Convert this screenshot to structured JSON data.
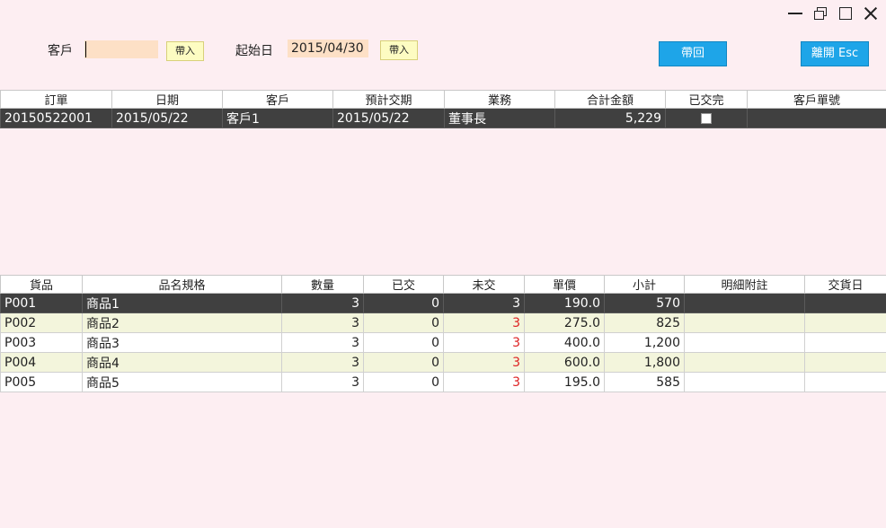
{
  "filters": {
    "customer_label": "客戶",
    "customer_value": "",
    "import_label": "帶入",
    "start_label": "起始日",
    "start_value": "2015/04/30",
    "import2_label": "帶入"
  },
  "actions": {
    "return_label": "帶回",
    "exit_label": "離開 Esc"
  },
  "orders": {
    "headers": [
      "訂單",
      "日期",
      "客戶",
      "預計交期",
      "業務",
      "合計金額",
      "已交完",
      "客戶單號"
    ],
    "rows": [
      {
        "order": "20150522001",
        "date": "2015/05/22",
        "customer": "客戶1",
        "due": "2015/05/22",
        "sales": "董事長",
        "total": "5,229",
        "done": false,
        "cust_no": ""
      }
    ]
  },
  "details": {
    "headers": [
      "貨品",
      "品名規格",
      "數量",
      "已交",
      "未交",
      "單價",
      "小計",
      "明細附註",
      "交貨日"
    ],
    "rows": [
      {
        "item": "P001",
        "name": "商品1",
        "qty": "3",
        "delivered": "0",
        "pending": "3",
        "price": "190.0",
        "subtotal": "570",
        "note": "",
        "date": ""
      },
      {
        "item": "P002",
        "name": "商品2",
        "qty": "3",
        "delivered": "0",
        "pending": "3",
        "price": "275.0",
        "subtotal": "825",
        "note": "",
        "date": ""
      },
      {
        "item": "P003",
        "name": "商品3",
        "qty": "3",
        "delivered": "0",
        "pending": "3",
        "price": "400.0",
        "subtotal": "1,200",
        "note": "",
        "date": ""
      },
      {
        "item": "P004",
        "name": "商品4",
        "qty": "3",
        "delivered": "0",
        "pending": "3",
        "price": "600.0",
        "subtotal": "1,800",
        "note": "",
        "date": ""
      },
      {
        "item": "P005",
        "name": "商品5",
        "qty": "3",
        "delivered": "0",
        "pending": "3",
        "price": "195.0",
        "subtotal": "585",
        "note": "",
        "date": ""
      }
    ]
  },
  "colors": {
    "accent": "#1ea5e8",
    "selected_row": "#404040",
    "alt_row": "#f3f5dc",
    "pending_red": "#d22222"
  }
}
